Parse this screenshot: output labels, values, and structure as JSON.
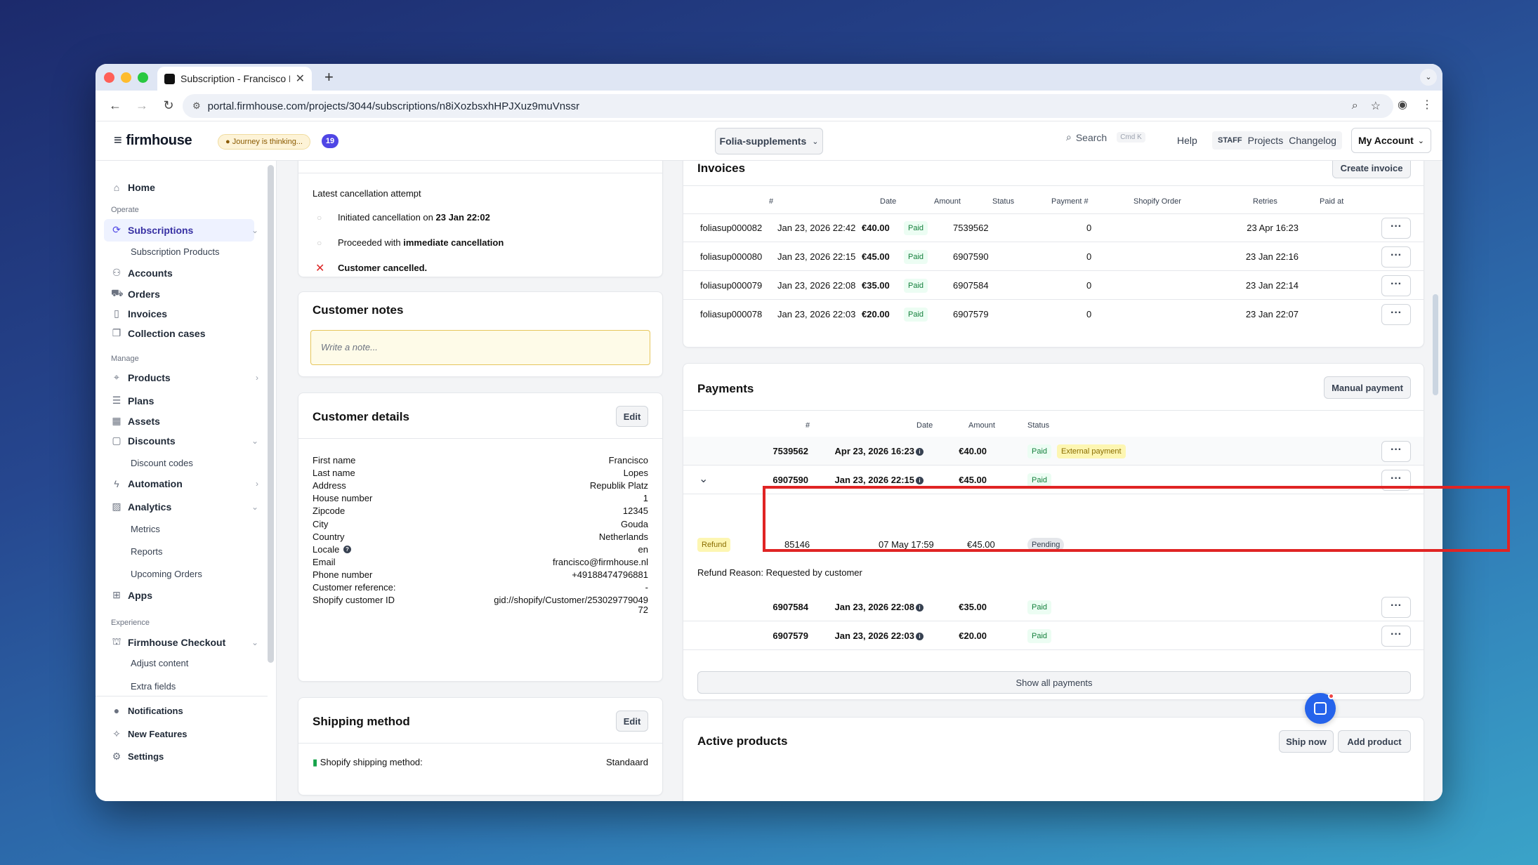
{
  "browser": {
    "tab_title": "Subscription - Francisco Lopes",
    "url": "portal.firmhouse.com/projects/3044/subscriptions/n8iXozbsxhHPJXuz9muVnssr"
  },
  "header": {
    "logo": "firmhouse",
    "journey": "Journey is thinking...",
    "badge": "19",
    "project": "Folia-supplements",
    "search": "Search",
    "search_kbd": "Cmd K",
    "help": "Help",
    "staff": "STAFF",
    "projects": "Projects",
    "changelog": "Changelog",
    "account": "My Account"
  },
  "sidebar": {
    "home": "Home",
    "operate": "Operate",
    "subscriptions": "Subscriptions",
    "subscription_products": "Subscription Products",
    "accounts": "Accounts",
    "orders": "Orders",
    "invoices": "Invoices",
    "collection_cases": "Collection cases",
    "manage": "Manage",
    "products": "Products",
    "plans": "Plans",
    "assets": "Assets",
    "discounts": "Discounts",
    "discount_codes": "Discount codes",
    "automation": "Automation",
    "analytics": "Analytics",
    "metrics": "Metrics",
    "reports": "Reports",
    "upcoming_orders": "Upcoming Orders",
    "apps": "Apps",
    "experience": "Experience",
    "checkout": "Firmhouse Checkout",
    "adjust_content": "Adjust content",
    "extra_fields": "Extra fields",
    "notifications": "Notifications",
    "new_features": "New Features",
    "settings": "Settings"
  },
  "cancellation": {
    "title": "Latest cancellation attempt",
    "step1_pre": "Initiated cancellation on",
    "step1_bold": "23 Jan 22:02",
    "step2_pre": "Proceeded with",
    "step2_bold": "immediate cancellation",
    "step3": "Customer cancelled."
  },
  "notes": {
    "title": "Customer notes",
    "placeholder": "Write a note..."
  },
  "customer": {
    "title": "Customer details",
    "edit": "Edit",
    "fields": [
      {
        "k": "First name",
        "v": "Francisco"
      },
      {
        "k": "Last name",
        "v": "Lopes"
      },
      {
        "k": "Address",
        "v": "Republik Platz"
      },
      {
        "k": "House number",
        "v": "1"
      },
      {
        "k": "Zipcode",
        "v": "12345"
      },
      {
        "k": "City",
        "v": "Gouda"
      },
      {
        "k": "Country",
        "v": "Netherlands"
      },
      {
        "k": "Locale",
        "v": "en"
      },
      {
        "k": "Email",
        "v": "francisco@firmhouse.nl"
      },
      {
        "k": "Phone number",
        "v": "+49188474796881"
      },
      {
        "k": "Customer reference:",
        "v": "-"
      },
      {
        "k": "Shopify customer ID",
        "v": "gid://shopify/Customer/253029779049"
      }
    ],
    "shopify_id_cont": "72"
  },
  "shipping": {
    "title": "Shipping method",
    "edit": "Edit",
    "label": "Shopify shipping method:",
    "value": "Standaard"
  },
  "invoices": {
    "title": "Invoices",
    "create": "Create invoice",
    "headers": [
      "#",
      "Date",
      "Amount",
      "Status",
      "Payment #",
      "Shopify Order",
      "Retries",
      "Paid at"
    ],
    "rows": [
      {
        "num": "foliasup000082",
        "date": "Jan 23, 2026 22:42",
        "amount": "€40.00",
        "status": "Paid",
        "payment": "7539562",
        "retries": "0",
        "paid_at": "23 Apr 16:23"
      },
      {
        "num": "foliasup000080",
        "date": "Jan 23, 2026 22:15",
        "amount": "€45.00",
        "status": "Paid",
        "payment": "6907590",
        "retries": "0",
        "paid_at": "23 Jan 22:16"
      },
      {
        "num": "foliasup000079",
        "date": "Jan 23, 2026 22:08",
        "amount": "€35.00",
        "status": "Paid",
        "payment": "6907584",
        "retries": "0",
        "paid_at": "23 Jan 22:14"
      },
      {
        "num": "foliasup000078",
        "date": "Jan 23, 2026 22:03",
        "amount": "€20.00",
        "status": "Paid",
        "payment": "6907579",
        "retries": "0",
        "paid_at": "23 Jan 22:07"
      }
    ]
  },
  "payments": {
    "title": "Payments",
    "manual": "Manual payment",
    "headers": [
      "#",
      "Date",
      "Amount",
      "Status"
    ],
    "rows": [
      {
        "num": "7539562",
        "date": "Apr 23, 2026 16:23",
        "amount": "€40.00",
        "status": "Paid",
        "extra": "External payment"
      },
      {
        "num": "6907590",
        "date": "Jan 23, 2026 22:15",
        "amount": "€45.00",
        "status": "Paid"
      },
      {
        "num": "6907584",
        "date": "Jan 23, 2026 22:08",
        "amount": "€35.00",
        "status": "Paid"
      },
      {
        "num": "6907579",
        "date": "Jan 23, 2026 22:03",
        "amount": "€20.00",
        "status": "Paid"
      }
    ],
    "refund": {
      "label": "Refund",
      "num": "85146",
      "date": "07 May 17:59",
      "amount": "€45.00",
      "status": "Pending",
      "reason": "Refund Reason: Requested by customer"
    },
    "show_all": "Show all payments"
  },
  "products": {
    "title": "Active products",
    "ship_now": "Ship now",
    "add_product": "Add product"
  }
}
